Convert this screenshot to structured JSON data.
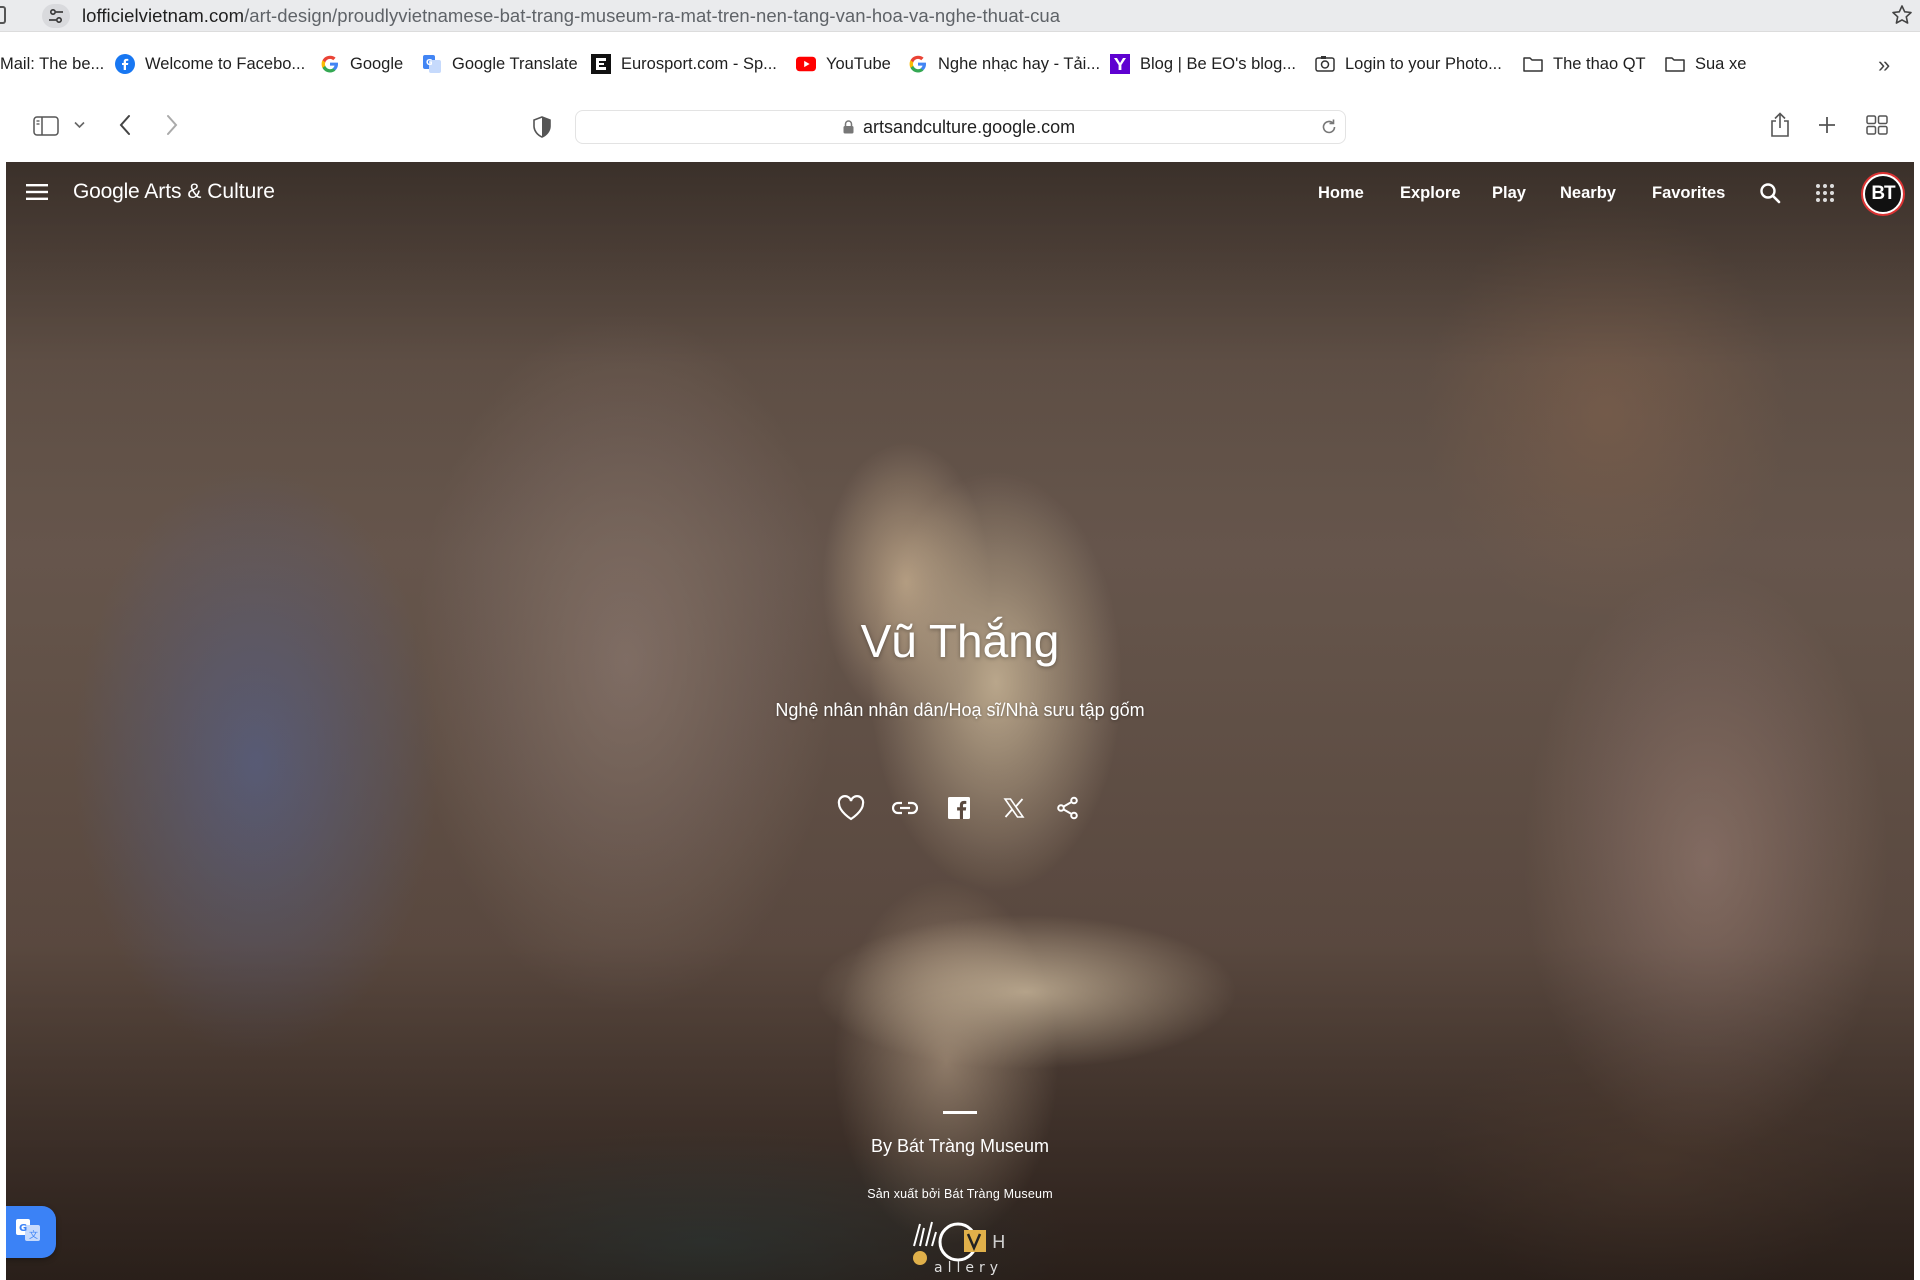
{
  "chrome": {
    "url_host": "lofficielvietnam.com",
    "url_path": "/art-design/proudlyvietnamese-bat-trang-museum-ra-mat-tren-nen-tang-van-hoa-va-nghe-thuat-cua"
  },
  "bookmarks": [
    {
      "label": "Mail: The be...",
      "icon": "none"
    },
    {
      "label": "Welcome to Facebo...",
      "icon": "facebook-icon"
    },
    {
      "label": "Google",
      "icon": "google-icon"
    },
    {
      "label": "Google Translate",
      "icon": "google-translate-icon"
    },
    {
      "label": "Eurosport.com - Sp...",
      "icon": "eurosport-icon"
    },
    {
      "label": "YouTube",
      "icon": "youtube-icon"
    },
    {
      "label": "Nghe nhạc hay - Tải...",
      "icon": "google-icon"
    },
    {
      "label": "Blog | Be EO's blog...",
      "icon": "yahoo-icon"
    },
    {
      "label": "Login to your Photo...",
      "icon": "camera-icon"
    },
    {
      "label": "The thao QT",
      "icon": "folder-icon"
    },
    {
      "label": "Sua xe",
      "icon": "folder-icon"
    }
  ],
  "toolbar": {
    "address": "artsandculture.google.com"
  },
  "site": {
    "logo_google": "Google",
    "logo_rest": "Arts & Culture",
    "nav": [
      "Home",
      "Explore",
      "Play",
      "Nearby",
      "Favorites"
    ],
    "avatar_initials": "BT"
  },
  "hero": {
    "title": "Vũ Thắng",
    "subtitle": "Nghệ nhân nhân dân/Hoạ sĩ/Nhà sưu tập gốm",
    "byline": "By Bát Tràng Museum",
    "produced_by": "Sản xuất bởi Bát Tràng Museum"
  },
  "colors": {
    "translate_button": "#3b82f6",
    "avatar_ring": "#dd3333"
  }
}
